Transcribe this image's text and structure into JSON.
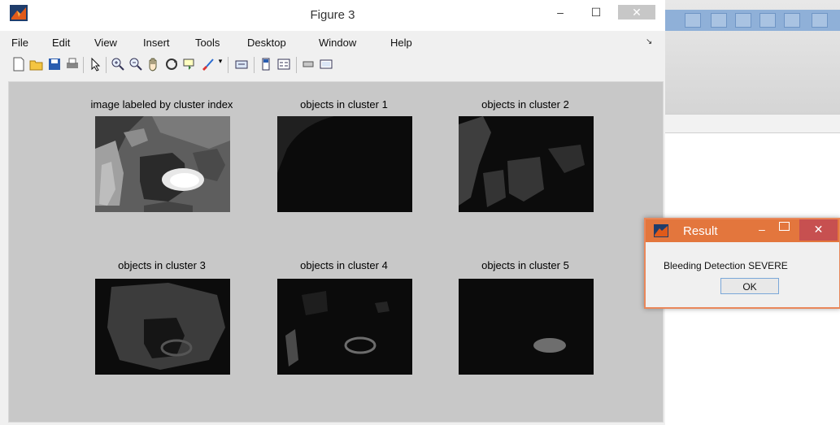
{
  "figure_window": {
    "title": "Figure 3",
    "minimize": "–",
    "maximize": "☐",
    "close": "✕"
  },
  "menu": {
    "items": [
      "File",
      "Edit",
      "View",
      "Insert",
      "Tools",
      "Desktop",
      "Window",
      "Help"
    ],
    "dock": "↘"
  },
  "toolbar": {
    "icons": [
      "new-figure-icon",
      "open-file-icon",
      "save-icon",
      "print-icon",
      "pointer-icon",
      "zoom-in-icon",
      "zoom-out-icon",
      "pan-icon",
      "rotate-3d-icon",
      "data-cursor-icon",
      "brush-icon",
      "brush-dropdown-icon",
      "link-plot-icon",
      "insert-colorbar-icon",
      "insert-legend-icon",
      "hide-plot-tools-icon",
      "show-plot-tools-icon"
    ]
  },
  "axes": [
    {
      "title": "image labeled by cluster index"
    },
    {
      "title": "objects in cluster 1"
    },
    {
      "title": "objects in cluster 2"
    },
    {
      "title": "objects in cluster 3"
    },
    {
      "title": "objects in cluster 4"
    },
    {
      "title": "objects in cluster 5"
    }
  ],
  "result_dialog": {
    "title": "Result",
    "minimize": "–",
    "close": "✕",
    "message": "Bleeding Detection SEVERE",
    "ok_label": "OK"
  },
  "colors": {
    "dialog_accent": "#e3763d",
    "close_red": "#c75050"
  }
}
